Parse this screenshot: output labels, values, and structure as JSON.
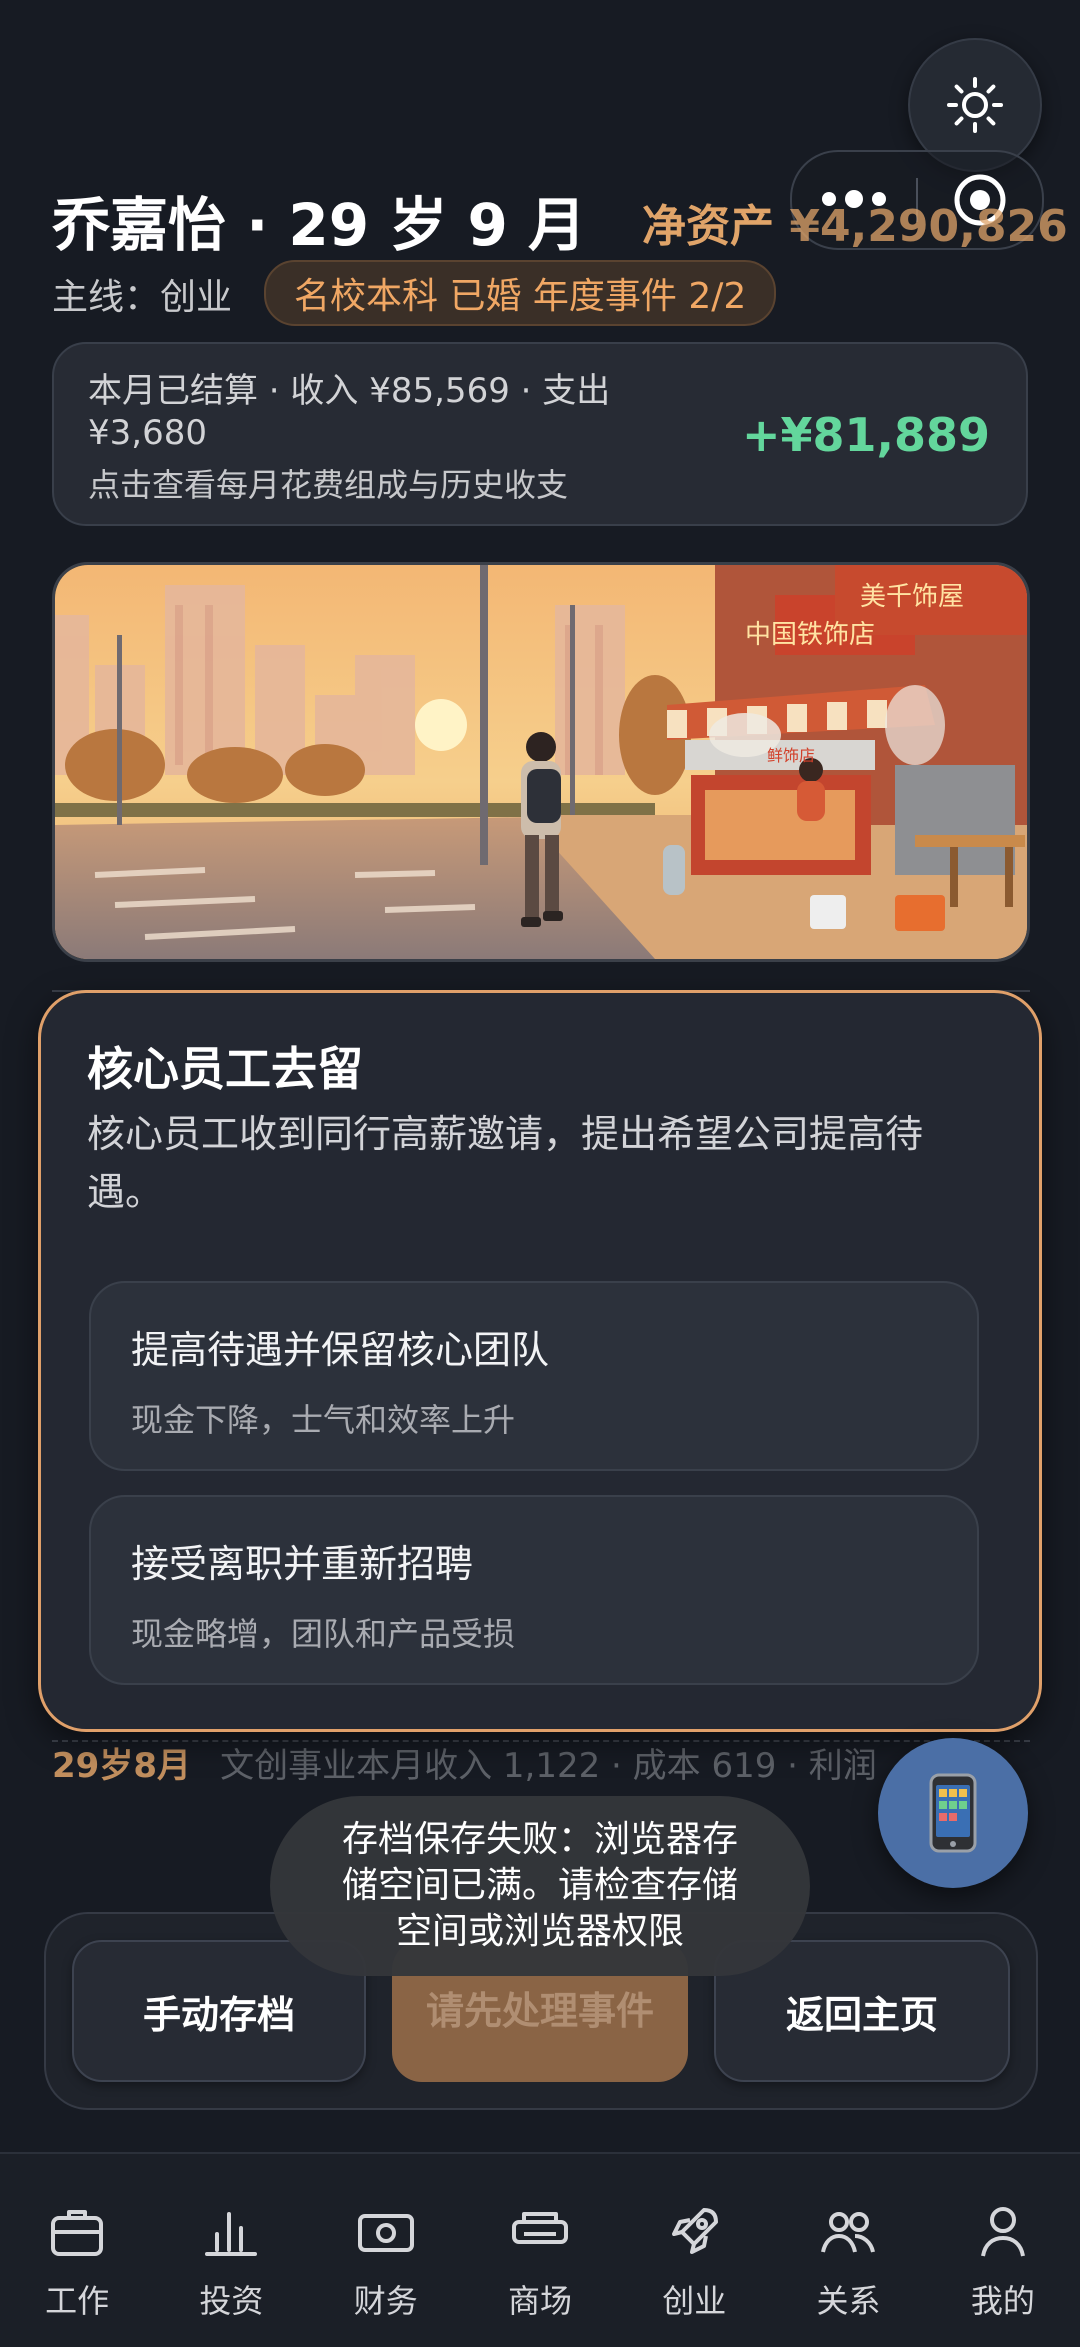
{
  "header": {
    "name_age": "乔嘉怡 · 29 岁 9 月",
    "networth_label": "净资产",
    "networth_value": "¥4,290,826",
    "mainline": "主线：创业",
    "tags": "名校本科 已婚 年度事件 2/2"
  },
  "summary": {
    "line1": "本月已结算 · 收入 ¥85,569 · 支出 ¥3,680",
    "line2": "点击查看每月花费组成与历史收支",
    "delta": "+¥81,889",
    "delta_color": "#63d69c"
  },
  "scene_signs": {
    "shop_sign": "中国铁饰店",
    "cart_sign": "鲜饰店",
    "top_sign": "美千饰屋"
  },
  "event": {
    "title": "核心员工去留",
    "description": "核心员工收到同行高薪邀请，提出希望公司提高待遇。",
    "options": [
      {
        "title": "提高待遇并保留核心团队",
        "desc": "现金下降，士气和效率上升"
      },
      {
        "title": "接受离职并重新招聘",
        "desc": "现金略增，团队和产品受损"
      }
    ]
  },
  "log": {
    "age": "29岁8月",
    "text": "文创事业本月收入 1,122 · 成本 619 · 利润"
  },
  "toast": "存档保存失败：浏览器存储空间已满。请检查存储空间或浏览器权限",
  "actions": {
    "save": "手动存档",
    "pending": "请先处理事件",
    "home": "返回主页"
  },
  "nav": [
    {
      "label": "工作",
      "icon": "briefcase-icon"
    },
    {
      "label": "投资",
      "icon": "bar-chart-icon"
    },
    {
      "label": "财务",
      "icon": "cash-icon"
    },
    {
      "label": "商场",
      "icon": "printer-icon"
    },
    {
      "label": "创业",
      "icon": "rocket-icon"
    },
    {
      "label": "关系",
      "icon": "people-icon"
    },
    {
      "label": "我的",
      "icon": "person-icon"
    }
  ],
  "colors": {
    "accent": "#e0a469",
    "modal_border": "#e0a06a",
    "positive": "#63d69c",
    "background": "#171b23"
  }
}
